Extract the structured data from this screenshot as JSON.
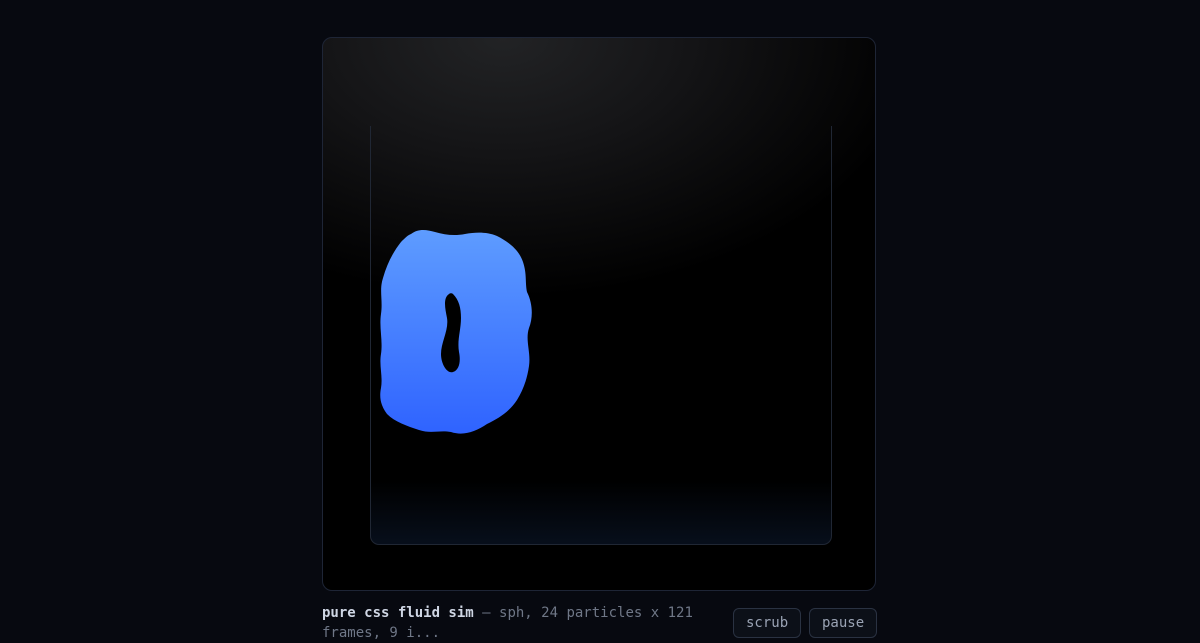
{
  "caption": {
    "title": "pure css fluid sim",
    "separator": " — ",
    "description": "sph, 24 particles x 121",
    "description_cont": "frames, 9 i..."
  },
  "controls": {
    "scrub_label": "scrub",
    "pause_label": "pause"
  },
  "colors": {
    "fluid_top": "#5e9cff",
    "fluid_bottom": "#2f63ff",
    "background": "#070910",
    "stage_border": "#1e2536"
  }
}
